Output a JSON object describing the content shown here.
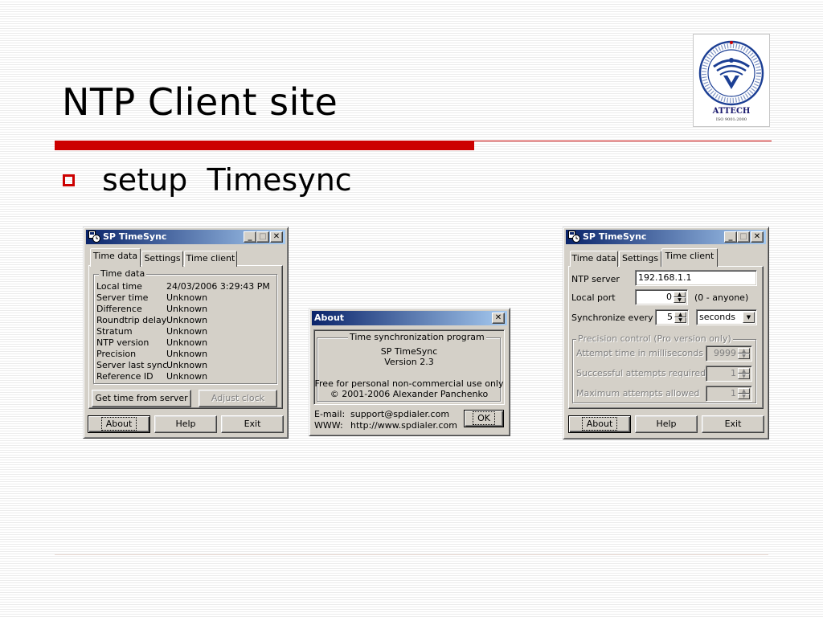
{
  "slide": {
    "title": "NTP Client site",
    "bullet": "setup  Timesync",
    "logo": {
      "name": "ATTECH",
      "iso": "ISO 9001:2000",
      "ring_text": "VIETNAM AIR TRAFFIC MANAGEMENT"
    }
  },
  "window_time_data": {
    "title": "SP TimeSync",
    "tabs": [
      "Time data",
      "Settings",
      "Time client"
    ],
    "active_tab": "Time data",
    "group_title": "Time data",
    "rows": [
      {
        "label": "Local time",
        "value": "24/03/2006 3:29:43 PM"
      },
      {
        "label": "Server time",
        "value": "Unknown"
      },
      {
        "label": "Difference",
        "value": "Unknown"
      },
      {
        "label": "Roundtrip delay",
        "value": "Unknown"
      },
      {
        "label": "Stratum",
        "value": "Unknown"
      },
      {
        "label": "NTP version",
        "value": "Unknown"
      },
      {
        "label": "Precision",
        "value": "Unknown"
      },
      {
        "label": "Server last sync",
        "value": "Unknown"
      },
      {
        "label": "Reference ID",
        "value": "Unknown"
      }
    ],
    "get_time_button": "Get time from server",
    "adjust_clock_button": "Adjust clock",
    "about_button": "About",
    "help_button": "Help",
    "exit_button": "Exit"
  },
  "window_about": {
    "title": "About",
    "group_title": "Time synchronization program",
    "app_name": "SP TimeSync",
    "version": "Version 2.3",
    "license": "Free for personal non-commercial use only",
    "copyright": "© 2001-2006 Alexander Panchenko",
    "email_label": "E-mail:",
    "email": "support@spdialer.com",
    "www_label": "WWW:",
    "www": "http://www.spdialer.com",
    "ok_button": "OK"
  },
  "window_time_client": {
    "title": "SP TimeSync",
    "tabs": [
      "Time data",
      "Settings",
      "Time client"
    ],
    "active_tab": "Time client",
    "ntp_server_label": "NTP server",
    "ntp_server_value": "192.168.1.1",
    "local_port_label": "Local port",
    "local_port_value": "0",
    "local_port_hint": "(0 - anyone)",
    "sync_label": "Synchronize every",
    "sync_value": "5",
    "sync_unit": "seconds",
    "precision_group_title": "Precision control (Pro version only)",
    "attempt_time_label": "Attempt time in milliseconds",
    "attempt_time_value": "9999",
    "successful_label": "Successful attempts required",
    "successful_value": "1",
    "max_attempts_label": "Maximum attempts allowed",
    "max_attempts_value": "1",
    "about_button": "About",
    "help_button": "Help",
    "exit_button": "Exit"
  },
  "colors": {
    "accent_red": "#cc0000",
    "titlebar_start": "#0a246a",
    "titlebar_end": "#a6caf0",
    "window_face": "#d4d0c8"
  }
}
